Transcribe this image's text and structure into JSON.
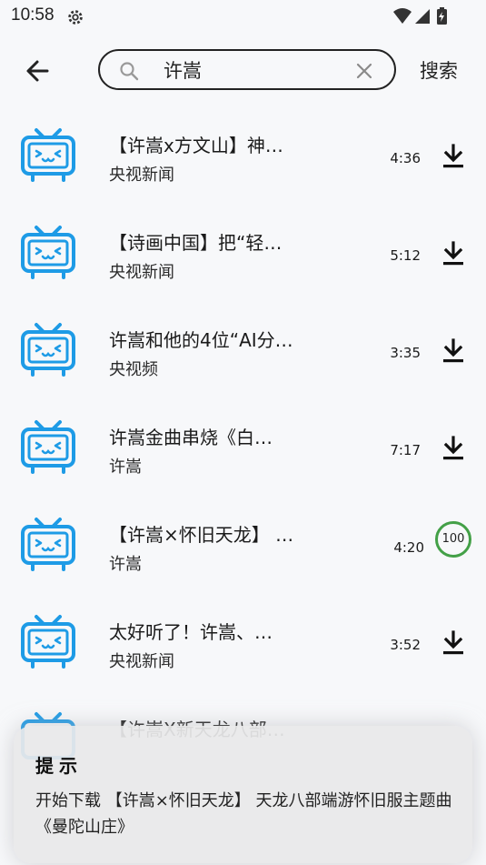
{
  "status": {
    "time": "10:58"
  },
  "search": {
    "query": "许嵩",
    "button_label": "搜索"
  },
  "results": [
    {
      "title": "【许嵩x方文山】神…",
      "source": "央视新闻",
      "duration": "4:36",
      "state": "download"
    },
    {
      "title": "【诗画中国】把“轻…",
      "source": "央视新闻",
      "duration": "5:12",
      "state": "download"
    },
    {
      "title": "许嵩和他的4位“AI分…",
      "source": "央视频",
      "duration": "3:35",
      "state": "download"
    },
    {
      "title": "许嵩金曲串烧《白…",
      "source": "许嵩",
      "duration": "7:17",
      "state": "download"
    },
    {
      "title": "【许嵩×怀旧天龙】 …",
      "source": "许嵩",
      "duration": "4:20",
      "state": "progress",
      "progress": "100"
    },
    {
      "title": "太好听了！许嵩、…",
      "source": "央视新闻",
      "duration": "3:52",
      "state": "download"
    }
  ],
  "partial": {
    "title": "【许嵩X新天龙八部…"
  },
  "toast": {
    "title": "提示",
    "message": "开始下载 【许嵩×怀旧天龙】 天龙八部端游怀旧服主题曲《曼陀山庄》"
  },
  "colors": {
    "accent": "#1e9be6",
    "progress": "#43a047"
  },
  "icons": [
    "settings-gear-icon",
    "wifi-icon",
    "cell-signal-icon",
    "battery-charging-icon",
    "back-arrow-icon",
    "search-icon",
    "clear-icon",
    "tv-icon",
    "download-icon"
  ]
}
